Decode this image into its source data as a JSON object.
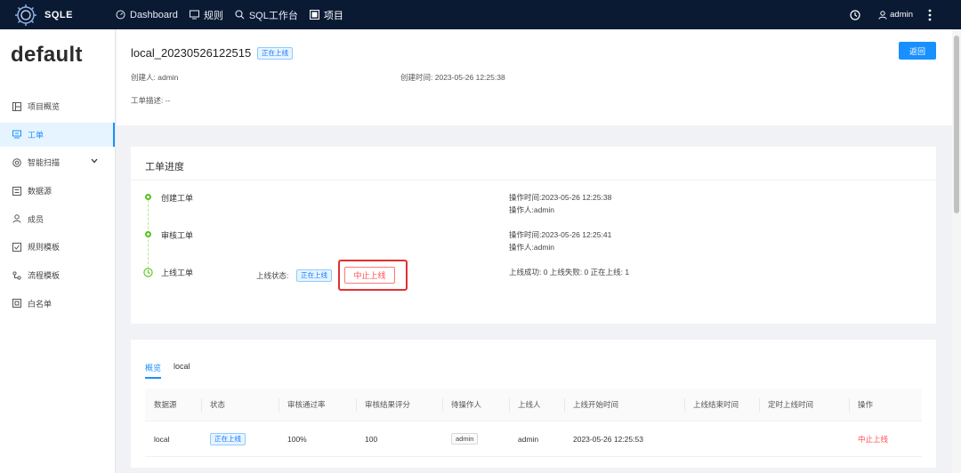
{
  "header": {
    "logo_text": "SQLE",
    "nav": [
      {
        "label": "Dashboard",
        "icon": "dashboard-icon"
      },
      {
        "label": "规则",
        "icon": "monitor-icon"
      },
      {
        "label": "SQL工作台",
        "icon": "search-icon"
      },
      {
        "label": "项目",
        "icon": "project-icon"
      }
    ],
    "user": "admin"
  },
  "sidebar": {
    "project_name": "default",
    "items": [
      {
        "label": "项目概览",
        "icon": "overview-icon"
      },
      {
        "label": "工单",
        "icon": "order-icon",
        "active": true
      },
      {
        "label": "智能扫描",
        "icon": "scan-icon"
      },
      {
        "label": "数据源",
        "icon": "database-icon"
      },
      {
        "label": "成员",
        "icon": "member-icon"
      },
      {
        "label": "规则模板",
        "icon": "rule-template-icon"
      },
      {
        "label": "流程模板",
        "icon": "flow-template-icon"
      },
      {
        "label": "白名单",
        "icon": "whitelist-icon"
      }
    ]
  },
  "order": {
    "title": "local_20230526122515",
    "status_tag": "正在上线",
    "back_label": "返回",
    "creator_label": "创建人:",
    "creator": "admin",
    "created_time_label": "创建时间:",
    "created_time": "2023-05-26 12:25:38",
    "desc_label": "工单描述:",
    "desc": "--"
  },
  "progress": {
    "title": "工单进度",
    "steps": [
      {
        "label": "创建工单",
        "time_label": "操作时间:",
        "time": "2023-05-26 12:25:38",
        "operator_label": "操作人:",
        "operator": "admin"
      },
      {
        "label": "审核工单",
        "time_label": "操作时间:",
        "time": "2023-05-26 12:25:41",
        "operator_label": "操作人:",
        "operator": "admin"
      },
      {
        "label": "上线工单",
        "status_label": "上线状态:",
        "status_tag": "正在上线",
        "stop_label": "中止上线",
        "summary": "上线成功: 0 上线失败: 0 正在上线: 1"
      }
    ]
  },
  "table": {
    "tabs": [
      "概览",
      "local"
    ],
    "columns": [
      "数据源",
      "状态",
      "审核通过率",
      "审核结果评分",
      "待操作人",
      "上线人",
      "上线开始时间",
      "上线结束时间",
      "定时上线时间",
      "操作"
    ],
    "rows": [
      {
        "datasource": "local",
        "status": "正在上线",
        "pass_rate": "100%",
        "score": "100",
        "pending_user": "admin",
        "executor": "admin",
        "start_time": "2023-05-26 12:25:53",
        "end_time": "",
        "scheduled_time": "",
        "action": "中止上线"
      }
    ]
  },
  "colors": {
    "primary": "#1890ff",
    "header_bg": "#0a1a33",
    "success": "#52c41a",
    "danger": "#ff4d4f",
    "highlight": "#e03131"
  }
}
